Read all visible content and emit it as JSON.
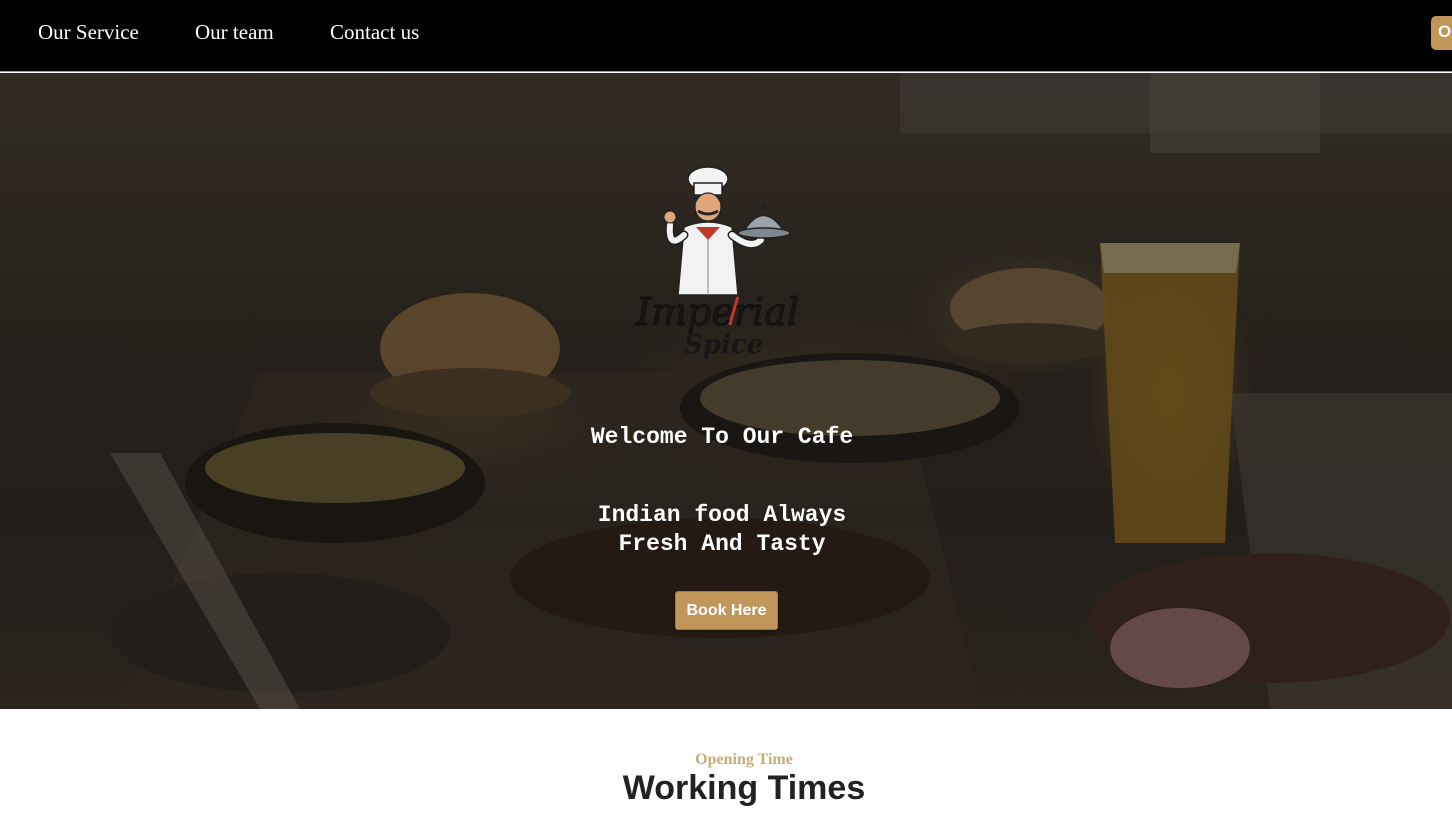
{
  "nav": {
    "links": [
      "Our Service",
      "Our team",
      "Contact us"
    ],
    "order_label": "Order"
  },
  "hero": {
    "logo_text": "Imperial Spice",
    "title": "Welcome To Our Cafe",
    "subtitle": "Indian food Always Fresh And Tasty",
    "book_label": "Book Here"
  },
  "hours": {
    "eyebrow": "Opening Time",
    "heading": "Working Times"
  },
  "colors": {
    "accent": "#c2965a",
    "eyebrow": "#c5ad79",
    "nav_bg": "#000000"
  },
  "icons": [
    "chef-mascot-icon",
    "serving-cloche-icon"
  ]
}
